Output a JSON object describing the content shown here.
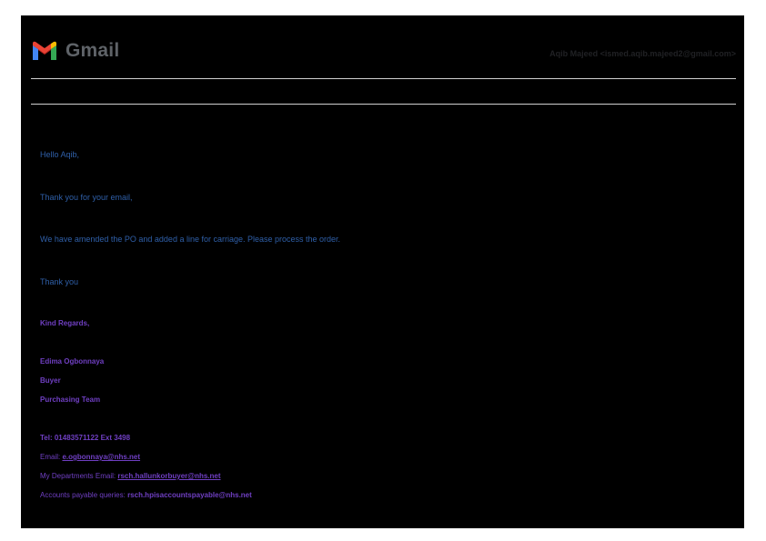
{
  "header": {
    "logo_text": "Gmail",
    "account": "Aqib Majeed <ismed.aqib.majeed2@gmail.com>"
  },
  "message": {
    "greeting": "Hello Aqib,",
    "thanks_line": "Thank you for your email,",
    "body_line": "We have amended the PO and added a line for carriage. Please process the order.",
    "closing": "Thank you"
  },
  "signature": {
    "regards": "Kind Regards,",
    "name": "Edima Ogbonnaya",
    "role": "Buyer",
    "team": "Purchasing Team",
    "tel": "Tel: 01483571122 Ext 3498",
    "email_label": "Email: ",
    "email": "e.ogbonnaya@nhs.net",
    "dept_label": "My Departments Email: ",
    "dept_email": "rsch.hallunkorbuyer@nhs.net",
    "accounts_label": "Accounts payable queries: ",
    "accounts_email": "rsch.hpisaccountspayable@nhs.net"
  },
  "colors": {
    "background": "#000000",
    "body_text": "#2f5fa8",
    "signature_text": "#6f3fc2"
  }
}
